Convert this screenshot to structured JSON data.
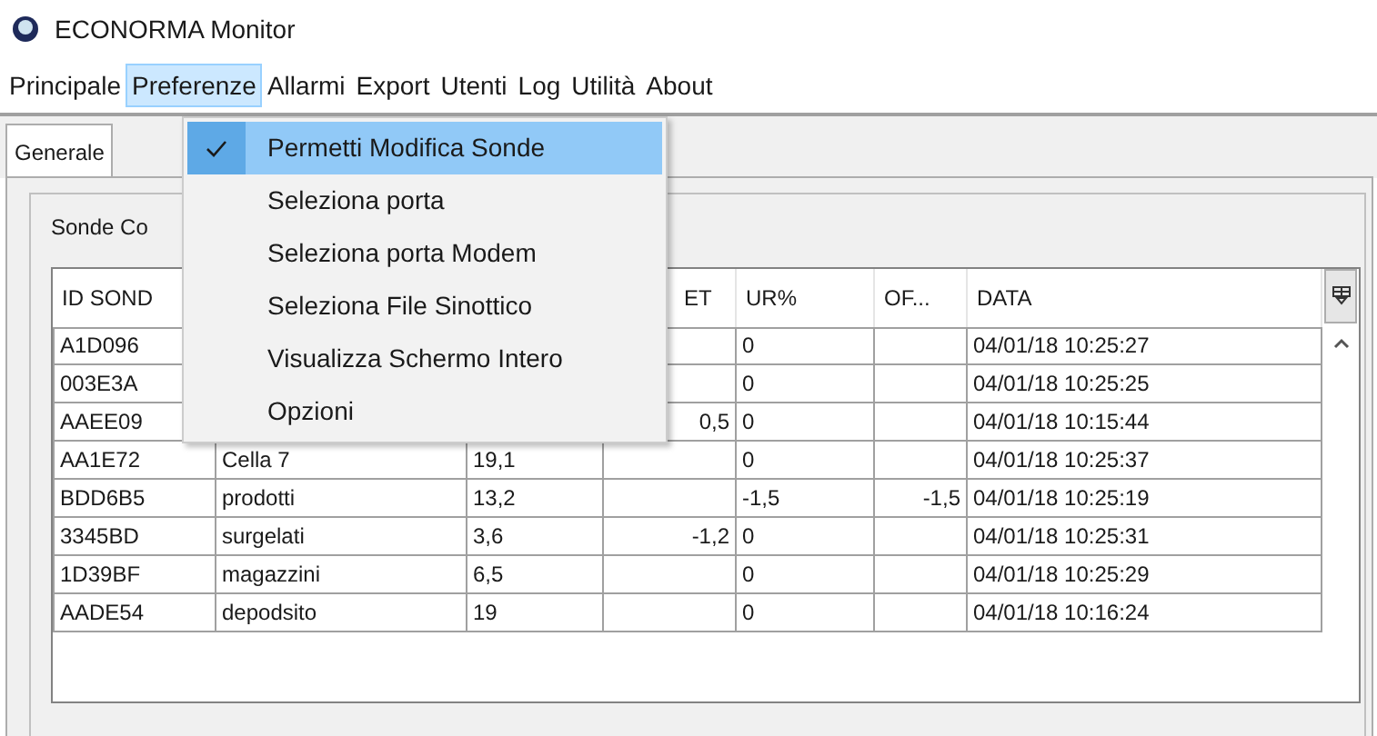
{
  "window": {
    "title": "ECONORMA Monitor"
  },
  "menu_bar": [
    {
      "label": "Principale",
      "selected": false
    },
    {
      "label": "Preferenze",
      "selected": true
    },
    {
      "label": "Allarmi",
      "selected": false
    },
    {
      "label": "Export",
      "selected": false
    },
    {
      "label": "Utenti",
      "selected": false
    },
    {
      "label": "Log",
      "selected": false
    },
    {
      "label": "Utilità",
      "selected": false
    },
    {
      "label": "About",
      "selected": false
    }
  ],
  "dropdown": [
    {
      "label": "Permetti Modifica Sonde",
      "checked": true,
      "selected": true
    },
    {
      "label": "Seleziona porta",
      "checked": false,
      "selected": false
    },
    {
      "label": "Seleziona porta Modem",
      "checked": false,
      "selected": false
    },
    {
      "label": "Seleziona File Sinottico",
      "checked": false,
      "selected": false
    },
    {
      "label": "Visualizza Schermo Intero",
      "checked": false,
      "selected": false
    },
    {
      "label": "Opzioni",
      "checked": false,
      "selected": false
    }
  ],
  "tabs": [
    {
      "label": "Generale",
      "selected": true
    }
  ],
  "group": {
    "title": "Sonde Co"
  },
  "table": {
    "columns": {
      "id": "ID SOND",
      "set": "ET",
      "ur": "UR%",
      "of": "OF...",
      "data": "DATA"
    },
    "rows": [
      {
        "id": "A1D096",
        "ur": "0",
        "data": "04/01/18 10:25:27"
      },
      {
        "id": "003E3A",
        "ur": "0",
        "data": "04/01/18 10:25:25"
      },
      {
        "id": "AAEE09",
        "set": "0,5",
        "ur": "0",
        "data": "04/01/18 10:15:44"
      },
      {
        "id": "AA1E72",
        "column_2": "Cella  7",
        "column_3": "19,1",
        "ur": "0",
        "data": "04/01/18 10:25:37"
      },
      {
        "id": "BDD6B5",
        "column_2": "prodotti",
        "column_3": "13,2",
        "ur": "-1,5",
        "of": "-1,5",
        "data": "04/01/18 10:25:19"
      },
      {
        "id": "3345BD",
        "column_2": "surgelati",
        "column_3": "3,6",
        "set": "-1,2",
        "ur": "0",
        "data": "04/01/18 10:25:31"
      },
      {
        "id": "1D39BF",
        "column_2": "magazzini",
        "column_3": "6,5",
        "ur": "0",
        "data": "04/01/18 10:25:29"
      },
      {
        "id": "AADE54",
        "column_2": "depodsito",
        "column_3": "19",
        "ur": "0",
        "data": "04/01/18 10:16:24"
      }
    ]
  }
}
